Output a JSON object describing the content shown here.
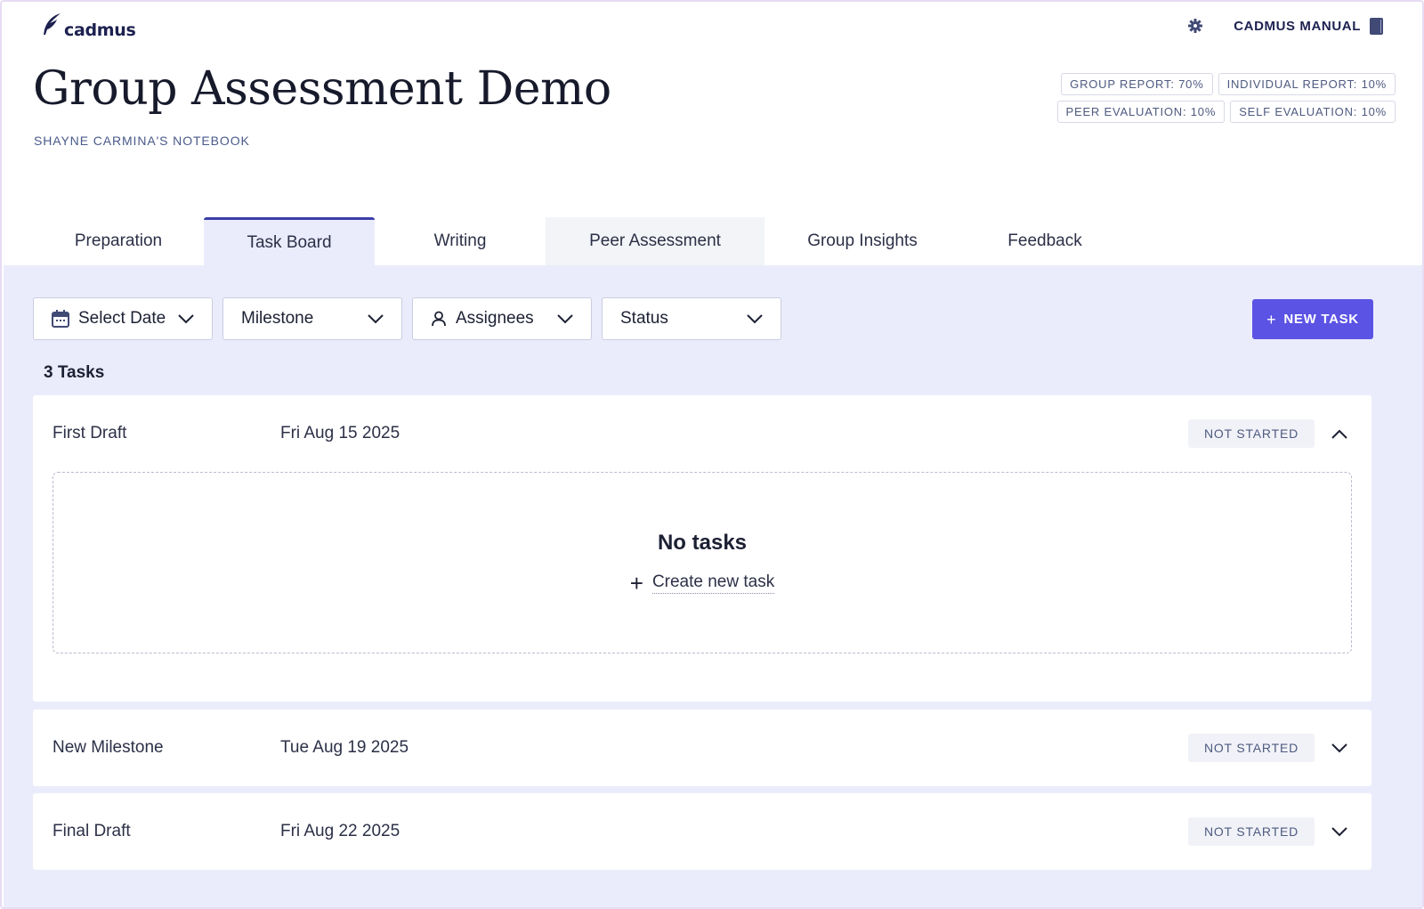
{
  "app": {
    "logo_text": "cadmus",
    "manual_label": "CADMUS MANUAL"
  },
  "header": {
    "title": "Group Assessment Demo",
    "subtitle": "SHAYNE CARMINA'S NOTEBOOK",
    "weights": [
      "GROUP REPORT: 70%",
      "INDIVIDUAL REPORT: 10%",
      "PEER EVALUATION: 10%",
      "SELF EVALUATION: 10%"
    ]
  },
  "tabs": [
    {
      "label": "Preparation"
    },
    {
      "label": "Task Board"
    },
    {
      "label": "Writing"
    },
    {
      "label": "Peer Assessment"
    },
    {
      "label": "Group Insights"
    },
    {
      "label": "Feedback"
    }
  ],
  "filters": {
    "date": "Select Date",
    "milestone": "Milestone",
    "assignees": "Assignees",
    "status": "Status"
  },
  "new_task_label": "NEW TASK",
  "task_count": "3 Tasks",
  "milestones": [
    {
      "name": "First Draft",
      "date": "Fri Aug 15 2025",
      "status": "NOT STARTED"
    },
    {
      "name": "New Milestone",
      "date": "Tue Aug 19 2025",
      "status": "NOT STARTED"
    },
    {
      "name": "Final Draft",
      "date": "Fri Aug 22 2025",
      "status": "NOT STARTED"
    }
  ],
  "empty": {
    "title": "No tasks",
    "create_label": "Create new task"
  },
  "colors": {
    "accent": "#5b53e4",
    "tab_active_border": "#3a3fa8",
    "board_bg": "#ebecfb",
    "text_dark": "#1d2150"
  },
  "icons": {
    "logo": "quill-icon",
    "settings": "gear-icon",
    "manual": "book-icon",
    "date_filter": "calendar-icon",
    "assignees_filter": "person-icon",
    "dropdown": "chevron-down-icon",
    "collapse": "chevron-up-icon"
  }
}
